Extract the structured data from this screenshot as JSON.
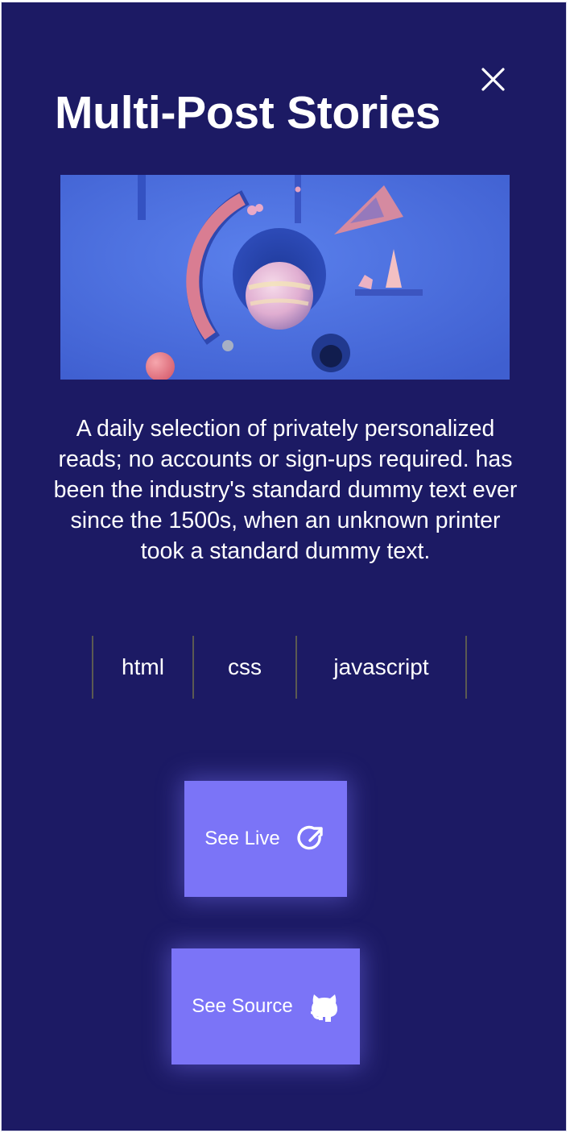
{
  "modal": {
    "title": "Multi-Post Stories",
    "close_icon": "close-icon",
    "image_alt": "Abstract 3D composition of pastel shapes on a blue wall",
    "description": "A daily selection of privately personalized reads; no accounts or sign-ups required. has been the industry's standard dummy text ever since the 1500s, when an unknown printer took a standard dummy text.",
    "tags": [
      "html",
      "css",
      "javascript"
    ],
    "see_live": {
      "label": "See Live",
      "icon": "external-link-icon"
    },
    "see_source": {
      "label": "See Source",
      "icon": "github-icon"
    }
  },
  "colors": {
    "background": "#1c1a64",
    "button": "#7b74f7",
    "text": "#ffffff",
    "tag_divider": "#5b5a52",
    "hero_wall": "#4a6fe0"
  }
}
